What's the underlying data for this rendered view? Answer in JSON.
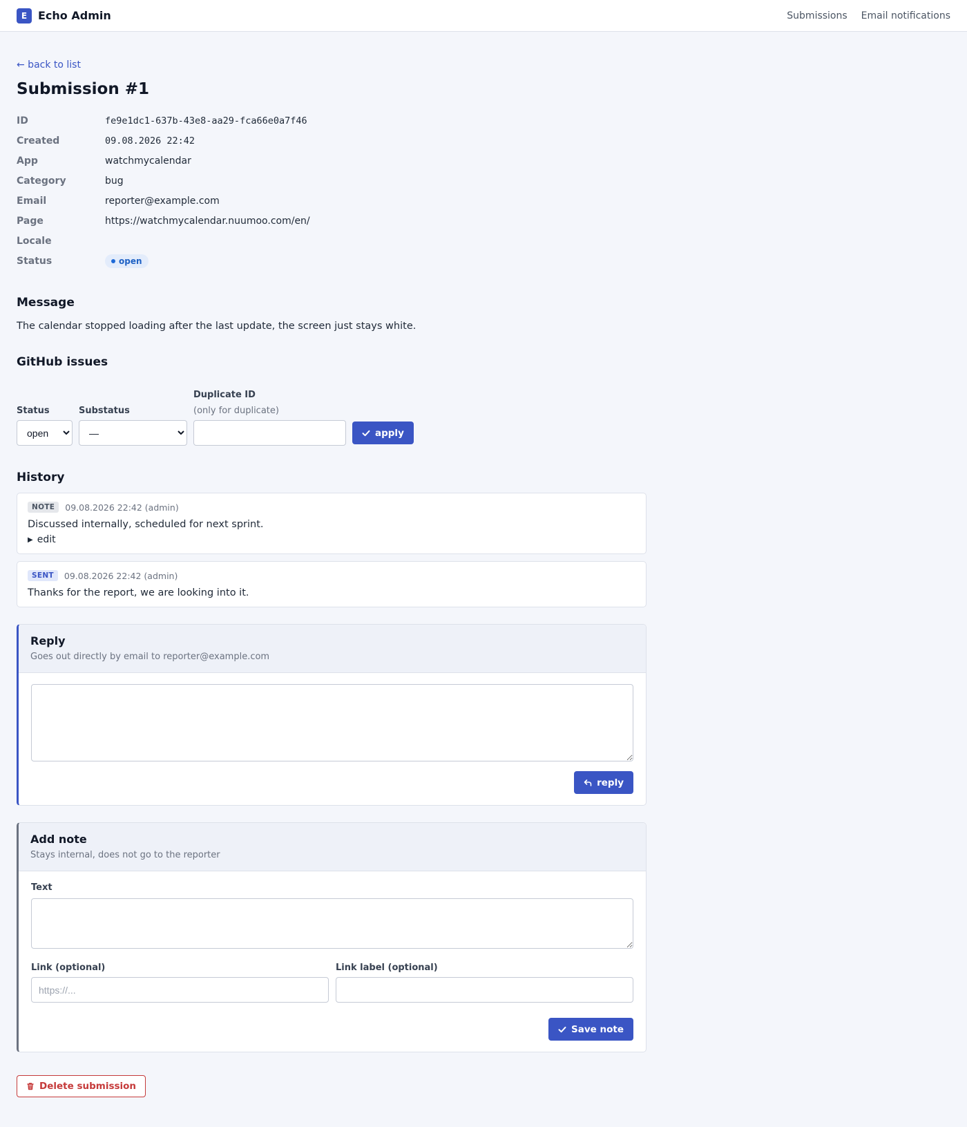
{
  "app": {
    "logo_letter": "E",
    "name": "Echo Admin",
    "nav": [
      "Submissions",
      "Email notifications"
    ]
  },
  "back_label": "← back to list",
  "page_title": "Submission #1",
  "meta": [
    {
      "label": "ID",
      "value": "fe9e1dc1-637b-43e8-aa29-fca66e0a7f46"
    },
    {
      "label": "Created",
      "value": "09.08.2026 22:42"
    },
    {
      "label": "App",
      "value": "watchmycalendar"
    },
    {
      "label": "Category",
      "value": "bug"
    },
    {
      "label": "Email",
      "value": "reporter@example.com"
    },
    {
      "label": "Page",
      "value": "https://watchmycalendar.nuumoo.com/en/"
    },
    {
      "label": "Locale",
      "value": ""
    },
    {
      "label": "Status",
      "value": "open"
    }
  ],
  "status_color": "#1e61c4",
  "message": {
    "heading": "Message",
    "text": "The calendar stopped loading after the last update, the screen just stays white."
  },
  "github": {
    "heading": "GitHub issues",
    "status_label": "Status",
    "status_value": "open",
    "substatus_label": "Substatus",
    "substatus_value": "—",
    "duplicate_label": "Duplicate ID",
    "duplicate_hint": "(only for duplicate)",
    "duplicate_value": "",
    "apply_label": "apply"
  },
  "history": {
    "heading": "History",
    "items": [
      {
        "tag": "NOTE",
        "meta": "09.08.2026 22:42 (admin)",
        "text": "Discussed internally, scheduled for next sprint.",
        "edit": "edit"
      },
      {
        "tag": "SENT",
        "meta": "09.08.2026 22:42 (admin)",
        "text": "Thanks for the report, we are looking into it."
      }
    ]
  },
  "reply": {
    "title": "Reply",
    "subtitle": "Goes out directly by email to reporter@example.com",
    "value": "",
    "button": "reply"
  },
  "note": {
    "title": "Add note",
    "subtitle": "Stays internal, does not go to the reporter",
    "text_label": "Text",
    "text_value": "",
    "link_label": "Link (optional)",
    "link_placeholder": "https://...",
    "link_value": "",
    "link_label_label": "Link label (optional)",
    "link_label_value": "",
    "button": "Save note"
  },
  "delete_label": "Delete submission",
  "colors": {
    "accent": "#3a55c4",
    "danger": "#c53a3a"
  }
}
